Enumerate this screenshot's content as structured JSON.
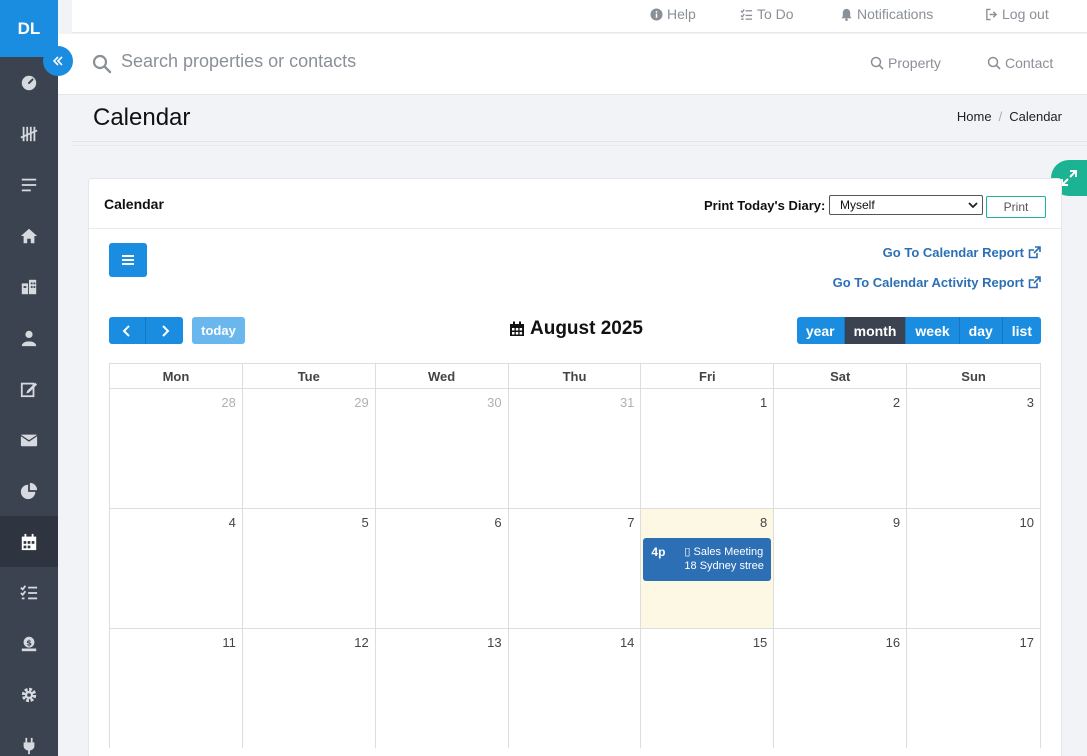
{
  "sidebar": {
    "logo": "DL",
    "items": [
      {
        "icon": "dashboard-icon"
      },
      {
        "icon": "tally-icon"
      },
      {
        "icon": "list-icon"
      },
      {
        "icon": "home-icon"
      },
      {
        "icon": "building-icon"
      },
      {
        "icon": "user-icon"
      },
      {
        "icon": "edit-icon"
      },
      {
        "icon": "mail-icon"
      },
      {
        "icon": "pie-chart-icon"
      },
      {
        "icon": "calendar-icon",
        "active": true
      },
      {
        "icon": "checklist-icon"
      },
      {
        "icon": "money-icon"
      },
      {
        "icon": "gear-icon"
      },
      {
        "icon": "plug-icon"
      }
    ]
  },
  "topbar": {
    "help": "Help",
    "todo": "To Do",
    "notifications": "Notifications",
    "logout": "Log out"
  },
  "search": {
    "placeholder": "Search properties or contacts",
    "property": "Property",
    "contact": "Contact"
  },
  "page": {
    "title": "Calendar",
    "breadcrumb": [
      "Home",
      "Calendar"
    ]
  },
  "card": {
    "title": "Calendar",
    "print_label": "Print Today's Diary:",
    "diary_value": "Myself",
    "print_button": "Print",
    "report_link": "Go To Calendar Report",
    "activity_report_link": "Go To Calendar Activity Report"
  },
  "calendar": {
    "today_label": "today",
    "month_title": "August 2025",
    "views": [
      "year",
      "month",
      "week",
      "day",
      "list"
    ],
    "active_view": "month",
    "days_of_week": [
      "Mon",
      "Tue",
      "Wed",
      "Thu",
      "Fri",
      "Sat",
      "Sun"
    ],
    "weeks": [
      [
        {
          "n": "28",
          "other": true
        },
        {
          "n": "29",
          "other": true
        },
        {
          "n": "30",
          "other": true
        },
        {
          "n": "31",
          "other": true
        },
        {
          "n": "1"
        },
        {
          "n": "2"
        },
        {
          "n": "3"
        }
      ],
      [
        {
          "n": "4"
        },
        {
          "n": "5"
        },
        {
          "n": "6"
        },
        {
          "n": "7"
        },
        {
          "n": "8",
          "today": true
        },
        {
          "n": "9"
        },
        {
          "n": "10"
        }
      ],
      [
        {
          "n": "11"
        },
        {
          "n": "12"
        },
        {
          "n": "13"
        },
        {
          "n": "14"
        },
        {
          "n": "15"
        },
        {
          "n": "16"
        },
        {
          "n": "17"
        }
      ]
    ],
    "event": {
      "time": "4p",
      "title": "▯ Sales Meeting",
      "address": "18 Sydney stree"
    }
  },
  "colors": {
    "accent": "#1a8de0",
    "sidebar": "#3b4350",
    "event": "#2c6fb5",
    "today_bg": "#fcf8e3",
    "expand": "#1bb394"
  }
}
